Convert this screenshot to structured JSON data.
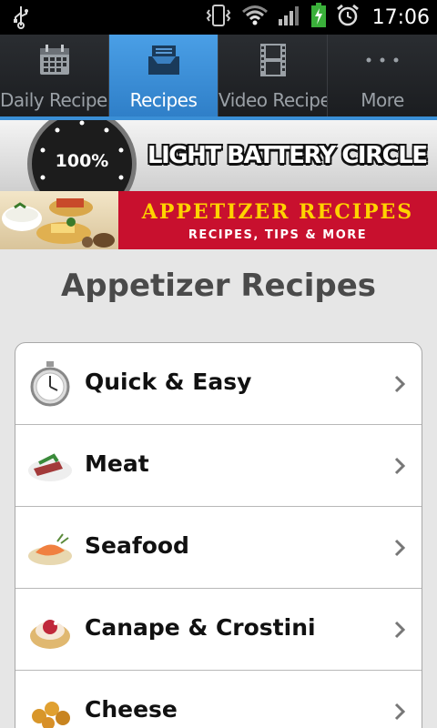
{
  "status_bar": {
    "time": "17:06",
    "icons": [
      "usb-icon",
      "vibrate-icon",
      "wifi-icon",
      "signal-icon",
      "battery-charging-icon",
      "alarm-icon"
    ]
  },
  "tabs": [
    {
      "label": "Daily Recipes",
      "icon": "calendar-icon",
      "active": false
    },
    {
      "label": "Recipes",
      "icon": "tray-icon",
      "active": true
    },
    {
      "label": "Video Recipe",
      "icon": "film-icon",
      "active": false
    },
    {
      "label": "More",
      "icon": "more-dots-icon",
      "active": false
    }
  ],
  "ads": {
    "battery": {
      "percent": "100%",
      "title": "LIGHT BATTERY CIRCLE"
    },
    "appetizer": {
      "title": "APPETIZER RECIPES",
      "subtitle": "RECIPES, TIPS & MORE"
    }
  },
  "page": {
    "title": "Appetizer Recipes"
  },
  "categories": [
    {
      "label": "Quick & Easy",
      "icon": "stopwatch-icon"
    },
    {
      "label": "Meat",
      "icon": "meat-dish-icon"
    },
    {
      "label": "Seafood",
      "icon": "seafood-dish-icon"
    },
    {
      "label": "Canape & Crostini",
      "icon": "canape-icon"
    },
    {
      "label": "Cheese",
      "icon": "cheese-bites-icon"
    }
  ],
  "colors": {
    "accent": "#3a8fd6",
    "ad_red": "#c8102e",
    "ad_yellow": "#ffd200"
  }
}
